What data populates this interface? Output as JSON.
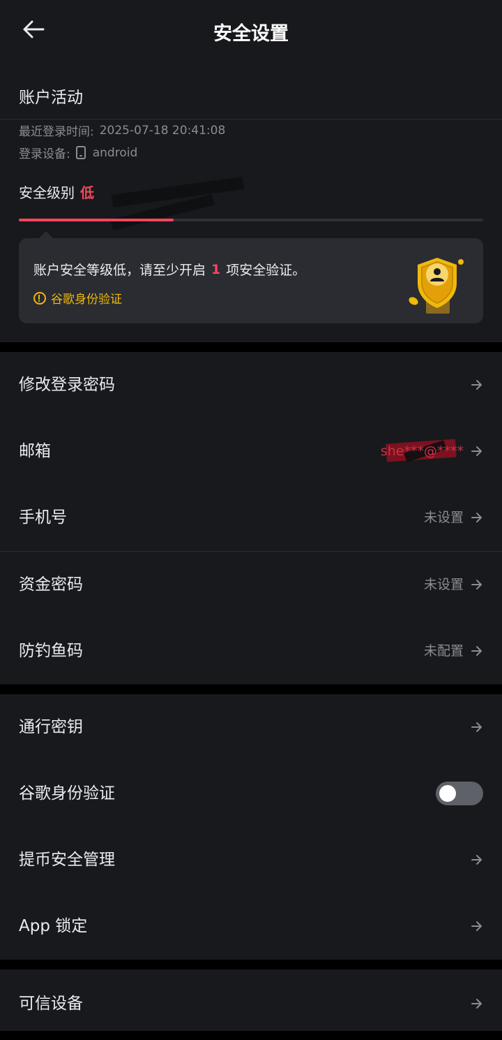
{
  "header": {
    "title": "安全设置"
  },
  "account_activity": {
    "title": "账户活动",
    "last_login_label": "最近登录时间:",
    "last_login_value": "2025-07-18 20:41:08",
    "device_label": "登录设备:",
    "device_value": "android"
  },
  "security_level": {
    "label": "安全级别",
    "value": "低",
    "progress_fraction": 0.333,
    "tip_text_before": "账户安全等级低，请至少开启",
    "tip_count": "1",
    "tip_text_after": "项安全验证。",
    "tip_link": "谷歌身份验证"
  },
  "group1": [
    {
      "label": "修改登录密码",
      "value": ""
    },
    {
      "label": "邮箱",
      "value": "she***@****"
    },
    {
      "label": "手机号",
      "value": "未设置"
    },
    {
      "label": "资金密码",
      "value": "未设置"
    },
    {
      "label": "防钓鱼码",
      "value": "未配置"
    }
  ],
  "group2": [
    {
      "label": "通行密钥"
    },
    {
      "label": "谷歌身份验证",
      "toggle_on": false
    },
    {
      "label": "提币安全管理"
    },
    {
      "label": "App 锁定"
    }
  ],
  "group3": [
    {
      "label": "可信设备"
    }
  ],
  "colors": {
    "background": "#000000",
    "surface": "#18191D",
    "card": "#2A2C31",
    "danger": "#F6465D",
    "accent": "#F0B90B",
    "text_primary": "#EAECEF",
    "text_secondary": "#8A8D93"
  }
}
